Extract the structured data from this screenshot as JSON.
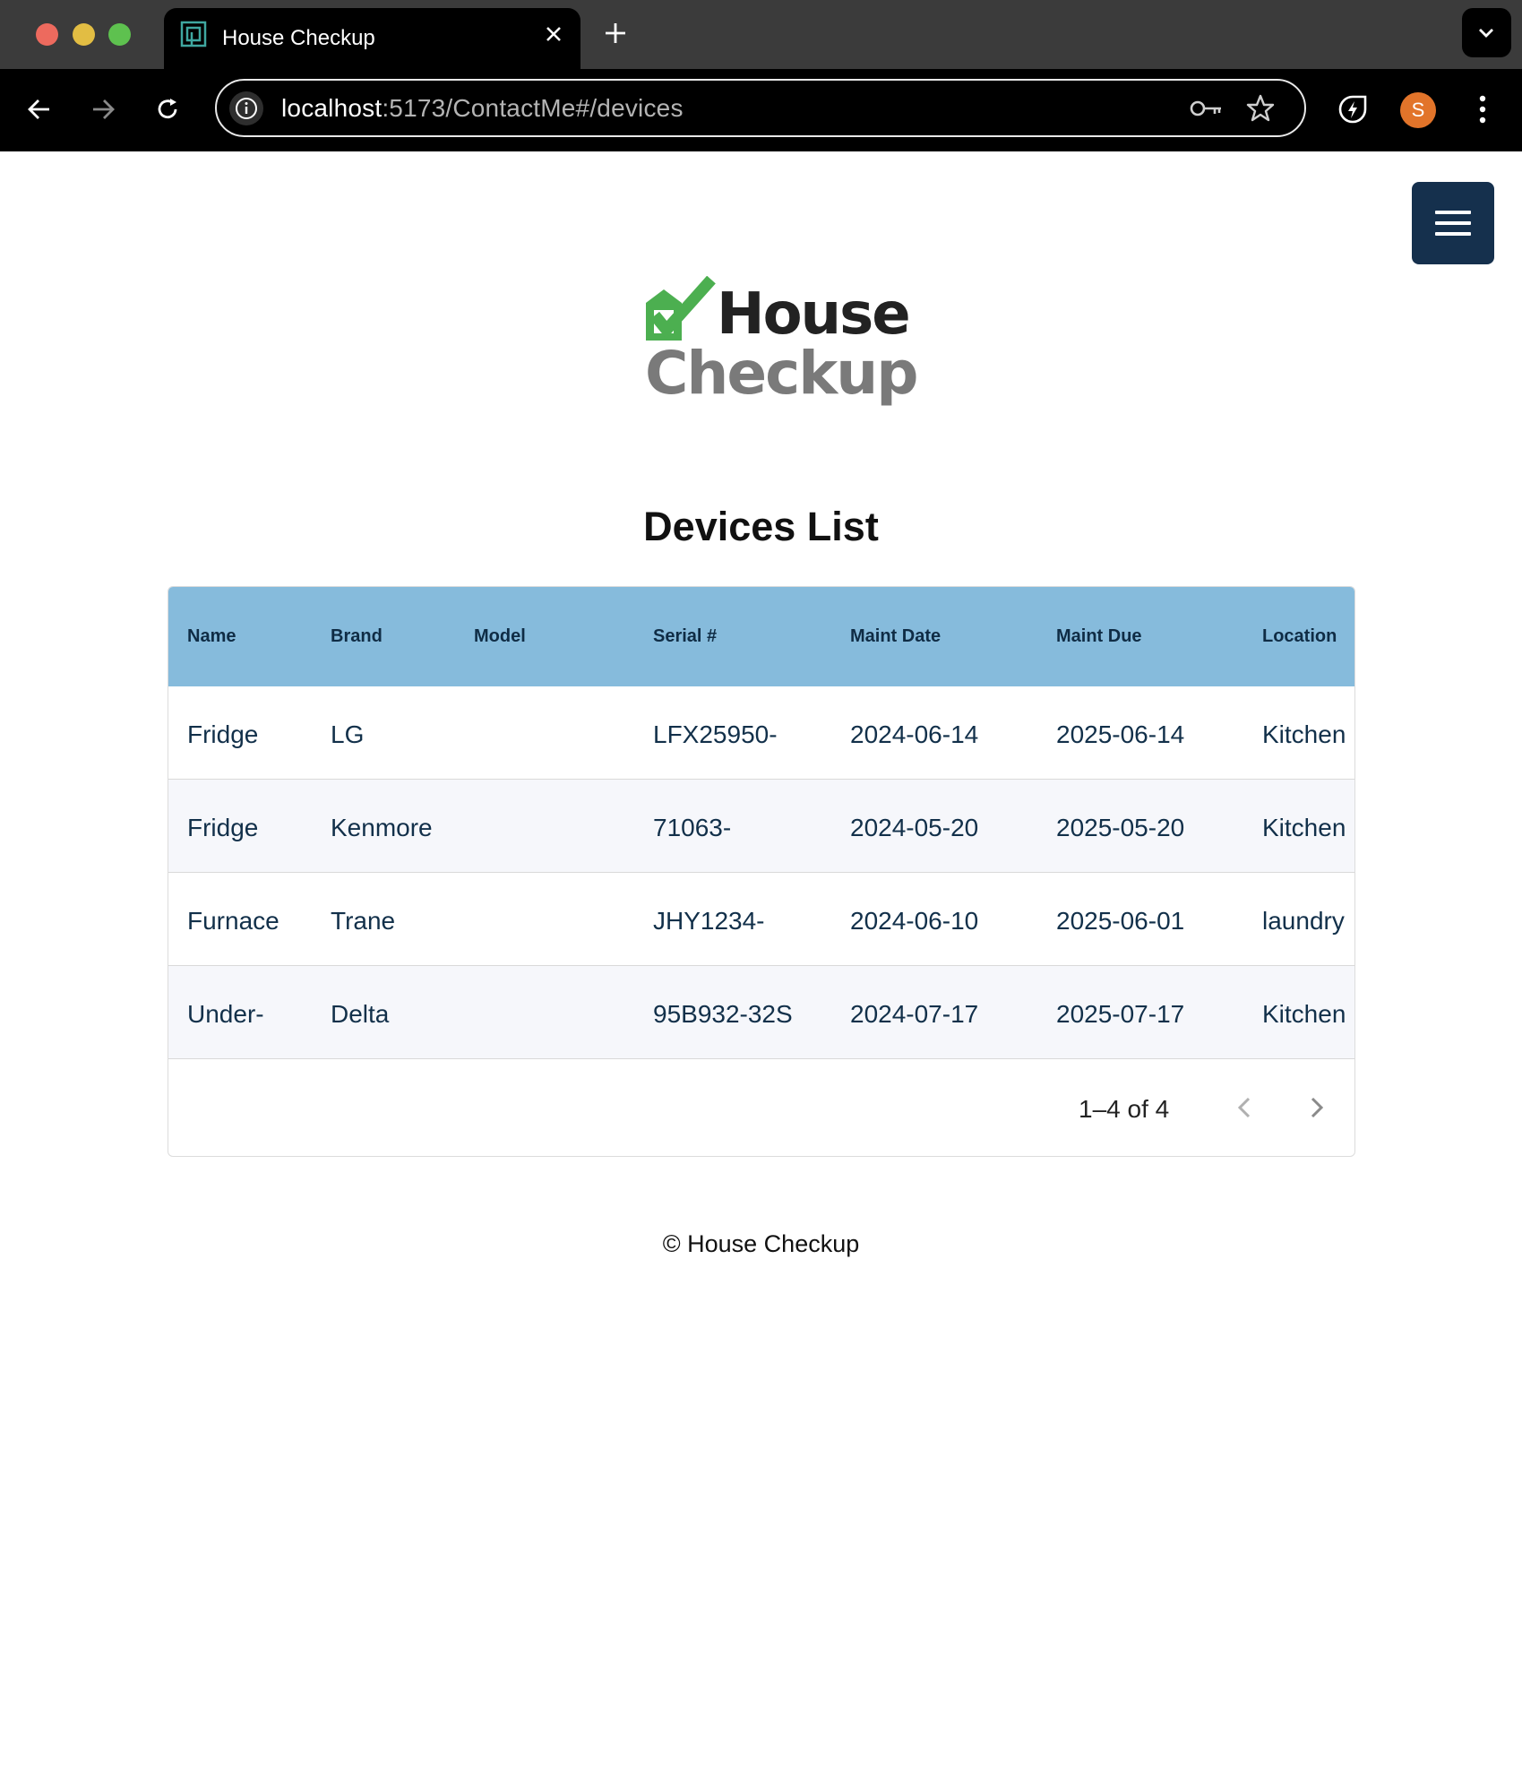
{
  "browser": {
    "tab_title": "House Checkup",
    "url_host": "localhost",
    "url_path": ":5173/ContactMe#/devices",
    "profile_initial": "S"
  },
  "logo": {
    "line1": "House",
    "line2": "Checkup"
  },
  "page_title": "Devices List",
  "table": {
    "columns": [
      "Name",
      "Brand",
      "Model",
      "Serial #",
      "Maint Date",
      "Maint Due",
      "Location"
    ],
    "rows": [
      [
        "Fridge",
        "LG",
        "",
        "LFX25950-",
        "2024-06-14",
        "2025-06-14",
        "Kitchen"
      ],
      [
        "Fridge",
        "Kenmore",
        "",
        "71063-",
        "2024-05-20",
        "2025-05-20",
        "Kitchen"
      ],
      [
        "Furnace",
        "Trane",
        "",
        "JHY1234-",
        "2024-06-10",
        "2025-06-01",
        "laundry"
      ],
      [
        "Under-",
        "Delta",
        "",
        "95B932-32S",
        "2024-07-17",
        "2025-07-17",
        "Kitchen"
      ]
    ],
    "pagination": "1–4 of 4"
  },
  "footer": "© House Checkup",
  "colors": {
    "header_bg": "#86bbdc",
    "menu_button_bg": "#15304d",
    "logo_check": "#4caf50",
    "avatar_bg": "#e2742a"
  }
}
